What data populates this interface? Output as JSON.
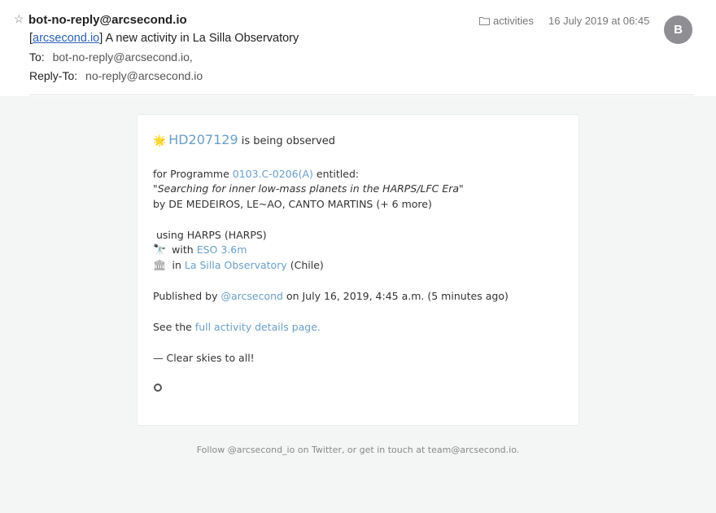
{
  "email": {
    "sender": "bot-no-reply@arcsecond.io",
    "subject_bracket_link": "arcsecond.io",
    "subject_text": "A new activity in La Silla Observatory",
    "to_label": "To:",
    "to_value": "bot-no-reply@arcsecond.io,",
    "reply_label": "Reply-To:",
    "reply_value": "no-reply@arcsecond.io",
    "folder": "activities",
    "date": "16 July 2019 at 06:45",
    "avatar_letter": "B"
  },
  "card": {
    "star_emoji": "🌟",
    "target": "HD207129",
    "being_observed": "is being observed",
    "programme_prefix": "for Programme",
    "programme_id": "0103.C-0206(A)",
    "programme_suffix": "entitled:",
    "programme_title": "\"Searching for inner low-mass planets in the HARPS/LFC Era\"",
    "authors": "by DE MEDEIROS, LE~AO, CANTO MARTINS (+ 6 more)",
    "instrument": "using HARPS (HARPS)",
    "telescope_emoji": "🔭",
    "telescope_prefix": "with",
    "telescope": "ESO 3.6m",
    "observatory_emoji": "🏛",
    "observatory_prefix": "in",
    "observatory": "La Silla Observatory",
    "observatory_country": "(Chile)",
    "published_prefix": "Published by",
    "published_by": "@arcsecond",
    "published_suffix": "on July 16, 2019, 4:45 a.m. (5 minutes ago)",
    "see_prefix": "See the",
    "details_link": "full activity details page.",
    "signoff": "— Clear skies to all!"
  },
  "footer": {
    "text": "Follow @arcsecond_io on Twitter, or get in touch at team@arcsecond.io."
  }
}
